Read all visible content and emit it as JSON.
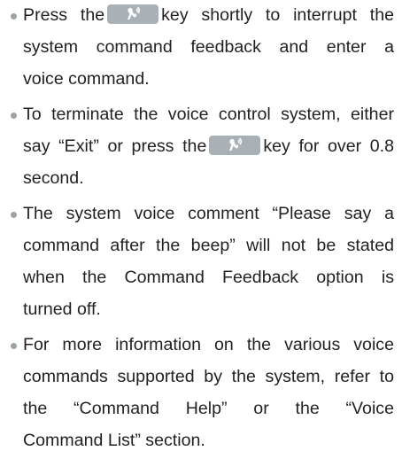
{
  "items": [
    {
      "lines": [
        {
          "before": "Press the",
          "key": "voice-key",
          "after": "key shortly to interrupt the"
        },
        {
          "text": "system command feedback and enter a"
        },
        {
          "text": "voice command."
        }
      ]
    },
    {
      "lines": [
        {
          "text": "To terminate the voice control system, either"
        },
        {
          "before": "say “Exit” or press the",
          "key": "voice-key",
          "after": "key for over 0.8"
        },
        {
          "text": "second."
        }
      ]
    },
    {
      "lines": [
        {
          "text": "The system voice comment “Please say a"
        },
        {
          "text": "command after the beep” will not be stated"
        },
        {
          "text": "when the Command Feedback option is"
        },
        {
          "text": "turned off."
        }
      ]
    },
    {
      "lines": [
        {
          "text": "For more information on the various voice"
        },
        {
          "text": "commands supported by the system, refer to"
        },
        {
          "text": "the “Command Help” or the “Voice"
        },
        {
          "text": "Command List” section."
        }
      ]
    }
  ],
  "colors": {
    "text": "#231f20",
    "bullet": "#9aa3a8",
    "key_background": "#a9b0b6",
    "key_icon": "#ffffff"
  }
}
